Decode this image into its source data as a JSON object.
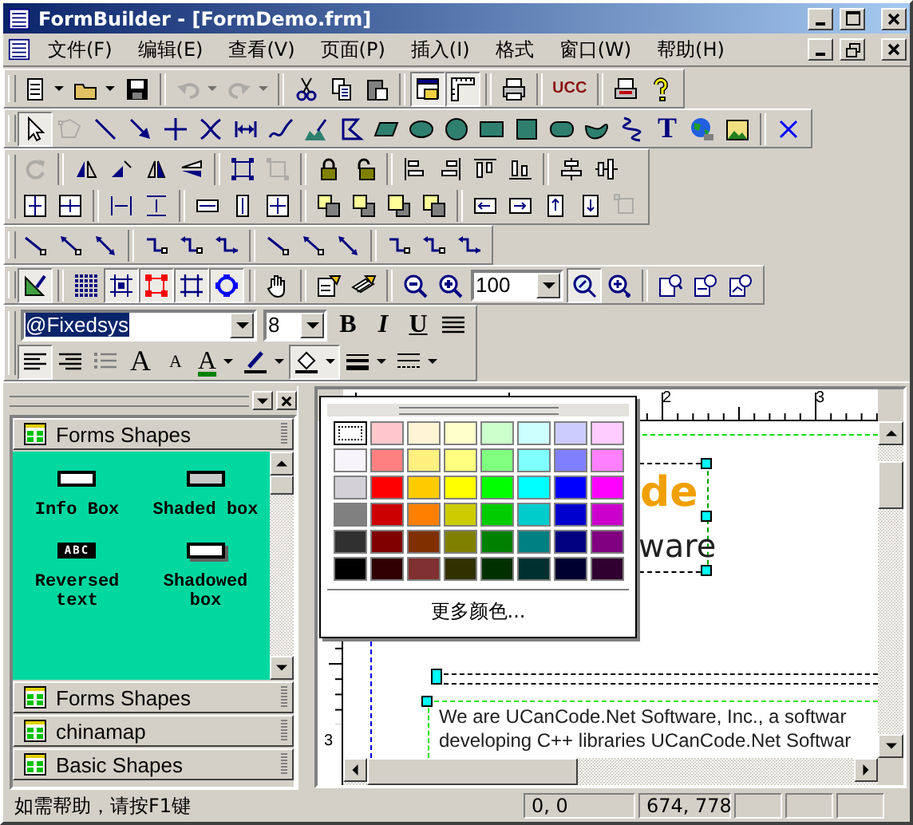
{
  "window": {
    "title": "FormBuilder - [FormDemo.frm]"
  },
  "menu_bar": {
    "items": [
      {
        "label": "文件(F)"
      },
      {
        "label": "编辑(E)"
      },
      {
        "label": "查看(V)"
      },
      {
        "label": "页面(P)"
      },
      {
        "label": "插入(I)"
      },
      {
        "label": "格式"
      },
      {
        "label": "窗口(W)"
      },
      {
        "label": "帮助(H)"
      }
    ]
  },
  "toolbars": [
    {
      "rows": [
        [
          {
            "kind": "split_button",
            "pressed": false,
            "disabled": false
          },
          {
            "kind": "split_button",
            "pressed": false,
            "disabled": false
          },
          {
            "kind": "button",
            "pressed": false,
            "disabled": false
          },
          {
            "kind": "separator"
          },
          {
            "kind": "split_button",
            "pressed": false,
            "disabled": true
          },
          {
            "kind": "split_button",
            "pressed": false,
            "disabled": true
          },
          {
            "kind": "separator"
          },
          {
            "kind": "button",
            "pressed": false,
            "disabled": false
          },
          {
            "kind": "button",
            "pressed": false,
            "disabled": false
          },
          {
            "kind": "button",
            "pressed": false,
            "disabled": false
          },
          {
            "kind": "separator"
          },
          {
            "kind": "button",
            "pressed": true,
            "disabled": false
          },
          {
            "kind": "button",
            "pressed": true,
            "disabled": false
          },
          {
            "kind": "separator"
          },
          {
            "kind": "button",
            "pressed": false,
            "disabled": false
          },
          {
            "kind": "separator"
          },
          {
            "kind": "button",
            "label": "UCC",
            "pressed": false,
            "disabled": false
          },
          {
            "kind": "separator"
          },
          {
            "kind": "button",
            "pressed": false,
            "disabled": false
          },
          {
            "kind": "button",
            "pressed": false,
            "disabled": false
          }
        ]
      ]
    },
    {
      "rows": [
        [
          {
            "kind": "button",
            "pressed": true,
            "disabled": false
          },
          {
            "kind": "button",
            "pressed": false,
            "disabled": true
          },
          {
            "kind": "button",
            "pressed": false,
            "disabled": false
          },
          {
            "kind": "button",
            "pressed": false,
            "disabled": false
          },
          {
            "kind": "button",
            "pressed": false,
            "disabled": false
          },
          {
            "kind": "button",
            "pressed": false,
            "disabled": false
          },
          {
            "kind": "button",
            "pressed": false,
            "disabled": false
          },
          {
            "kind": "button",
            "pressed": false,
            "disabled": false
          },
          {
            "kind": "button",
            "pressed": false,
            "disabled": false
          },
          {
            "kind": "button",
            "pressed": false,
            "disabled": false
          },
          {
            "kind": "button",
            "pressed": false,
            "disabled": false
          },
          {
            "kind": "button",
            "pressed": false,
            "disabled": false
          },
          {
            "kind": "button",
            "pressed": false,
            "disabled": false
          },
          {
            "kind": "button",
            "pressed": false,
            "disabled": false
          },
          {
            "kind": "button",
            "pressed": false,
            "disabled": false
          },
          {
            "kind": "button",
            "pressed": false,
            "disabled": false
          },
          {
            "kind": "button",
            "pressed": false,
            "disabled": false
          },
          {
            "kind": "button",
            "pressed": false,
            "disabled": false
          },
          {
            "kind": "button",
            "label": "T",
            "pressed": false,
            "disabled": false
          },
          {
            "kind": "button",
            "pressed": false,
            "disabled": false
          },
          {
            "kind": "button",
            "pressed": false,
            "disabled": false
          },
          {
            "kind": "separator"
          },
          {
            "kind": "button",
            "pressed": false,
            "disabled": false
          }
        ]
      ]
    },
    {
      "rows": [
        [
          {
            "kind": "button",
            "pressed": false,
            "disabled": true
          },
          {
            "kind": "separator"
          },
          {
            "kind": "button",
            "pressed": false,
            "disabled": false
          },
          {
            "kind": "button",
            "pressed": false,
            "disabled": false
          },
          {
            "kind": "button",
            "pressed": false,
            "disabled": false
          },
          {
            "kind": "button",
            "pressed": false,
            "disabled": false
          },
          {
            "kind": "separator"
          },
          {
            "kind": "button",
            "pressed": false,
            "disabled": false
          },
          {
            "kind": "button",
            "pressed": false,
            "disabled": true
          },
          {
            "kind": "separator"
          },
          {
            "kind": "button",
            "pressed": false,
            "disabled": false
          },
          {
            "kind": "button",
            "pressed": false,
            "disabled": false
          },
          {
            "kind": "separator"
          },
          {
            "kind": "button",
            "pressed": false,
            "disabled": false
          },
          {
            "kind": "button",
            "pressed": false,
            "disabled": false
          },
          {
            "kind": "button",
            "pressed": false,
            "disabled": false
          },
          {
            "kind": "button",
            "pressed": false,
            "disabled": false
          },
          {
            "kind": "separator"
          },
          {
            "kind": "button",
            "pressed": false,
            "disabled": false
          },
          {
            "kind": "button",
            "pressed": false,
            "disabled": false
          }
        ],
        [
          {
            "kind": "button",
            "pressed": false,
            "disabled": false
          },
          {
            "kind": "button",
            "pressed": false,
            "disabled": false
          },
          {
            "kind": "separator"
          },
          {
            "kind": "button",
            "pressed": false,
            "disabled": false
          },
          {
            "kind": "button",
            "pressed": false,
            "disabled": false
          },
          {
            "kind": "separator"
          },
          {
            "kind": "button",
            "pressed": false,
            "disabled": false
          },
          {
            "kind": "button",
            "pressed": false,
            "disabled": false
          },
          {
            "kind": "button",
            "pressed": false,
            "disabled": false
          },
          {
            "kind": "separator"
          },
          {
            "kind": "button",
            "pressed": false,
            "disabled": false
          },
          {
            "kind": "button",
            "pressed": false,
            "disabled": false
          },
          {
            "kind": "button",
            "pressed": false,
            "disabled": false
          },
          {
            "kind": "button",
            "pressed": false,
            "disabled": false
          },
          {
            "kind": "separator"
          },
          {
            "kind": "button",
            "pressed": false,
            "disabled": false
          },
          {
            "kind": "button",
            "pressed": false,
            "disabled": false
          },
          {
            "kind": "button",
            "pressed": false,
            "disabled": false
          },
          {
            "kind": "button",
            "pressed": false,
            "disabled": false
          },
          {
            "kind": "button",
            "pressed": false,
            "disabled": true
          }
        ]
      ]
    },
    {
      "rows": [
        [
          {
            "kind": "button",
            "pressed": false,
            "disabled": false
          },
          {
            "kind": "button",
            "pressed": false,
            "disabled": false
          },
          {
            "kind": "button",
            "pressed": false,
            "disabled": false
          },
          {
            "kind": "separator"
          },
          {
            "kind": "button",
            "pressed": false,
            "disabled": false
          },
          {
            "kind": "button",
            "pressed": false,
            "disabled": false
          },
          {
            "kind": "button",
            "pressed": false,
            "disabled": false
          },
          {
            "kind": "separator"
          },
          {
            "kind": "button",
            "pressed": false,
            "disabled": false
          },
          {
            "kind": "button",
            "pressed": false,
            "disabled": false
          },
          {
            "kind": "button",
            "pressed": false,
            "disabled": false
          },
          {
            "kind": "separator"
          },
          {
            "kind": "button",
            "pressed": false,
            "disabled": false
          },
          {
            "kind": "button",
            "pressed": false,
            "disabled": false
          },
          {
            "kind": "button",
            "pressed": false,
            "disabled": false
          }
        ]
      ]
    },
    {
      "rows": [
        [
          {
            "kind": "button",
            "pressed": true,
            "disabled": false
          },
          {
            "kind": "separator"
          },
          {
            "kind": "button",
            "pressed": false,
            "disabled": false
          },
          {
            "kind": "button",
            "pressed": true,
            "disabled": false
          },
          {
            "kind": "button",
            "pressed": true,
            "disabled": false
          },
          {
            "kind": "button",
            "pressed": true,
            "disabled": false
          },
          {
            "kind": "button",
            "pressed": true,
            "disabled": false
          },
          {
            "kind": "separator"
          },
          {
            "kind": "button",
            "pressed": false,
            "disabled": false
          },
          {
            "kind": "separator"
          },
          {
            "kind": "button",
            "pressed": false,
            "disabled": false
          },
          {
            "kind": "button",
            "pressed": false,
            "disabled": false
          },
          {
            "kind": "separator"
          },
          {
            "kind": "button",
            "pressed": false,
            "disabled": false
          },
          {
            "kind": "button",
            "pressed": false,
            "disabled": false
          },
          {
            "kind": "combo",
            "value": "100",
            "selected": false
          },
          {
            "kind": "button",
            "pressed": true,
            "disabled": false
          },
          {
            "kind": "button",
            "pressed": false,
            "disabled": false
          },
          {
            "kind": "separator"
          },
          {
            "kind": "button",
            "pressed": false,
            "disabled": false
          },
          {
            "kind": "button",
            "pressed": false,
            "disabled": false
          },
          {
            "kind": "button",
            "pressed": false,
            "disabled": false
          }
        ]
      ]
    },
    {
      "rows": [
        [
          {
            "kind": "combo",
            "value": "@Fixedsys",
            "selected": true
          },
          {
            "kind": "combo",
            "value": "8",
            "selected": false
          },
          {
            "kind": "button",
            "label": "B",
            "pressed": false,
            "disabled": false
          },
          {
            "kind": "button",
            "label": "I",
            "pressed": false,
            "disabled": false
          },
          {
            "kind": "button",
            "label": "U",
            "pressed": false,
            "disabled": false
          },
          {
            "kind": "button",
            "pressed": false,
            "disabled": false
          }
        ],
        [
          {
            "kind": "button",
            "pressed": true,
            "disabled": false
          },
          {
            "kind": "button",
            "pressed": false,
            "disabled": false
          },
          {
            "kind": "button",
            "pressed": false,
            "disabled": false
          },
          {
            "kind": "button",
            "label": "A",
            "pressed": false,
            "disabled": false
          },
          {
            "kind": "button",
            "label": "A",
            "pressed": false,
            "disabled": false
          },
          {
            "kind": "split_button",
            "label": "A",
            "pressed": false,
            "disabled": false
          },
          {
            "kind": "split_button",
            "pressed": false,
            "disabled": false
          },
          {
            "kind": "split_button",
            "pressed": true,
            "disabled": false
          },
          {
            "kind": "split_button",
            "pressed": false,
            "disabled": false
          },
          {
            "kind": "split_button",
            "pressed": false,
            "disabled": false
          }
        ]
      ]
    }
  ],
  "shapes_panel": {
    "categories": [
      {
        "label": "Forms Shapes",
        "items": [
          {
            "label": "Info Box"
          },
          {
            "label": "Shaded box"
          },
          {
            "label": "Reversed text",
            "icon_text": "ABC"
          },
          {
            "label": "Shadowed box"
          }
        ]
      },
      {
        "label": "Forms Shapes"
      },
      {
        "label": "chinamap"
      },
      {
        "label": "Basic Shapes"
      }
    ]
  },
  "color_picker": {
    "colors": [
      {
        "color": "#ffffff",
        "selected": true
      },
      {
        "color": "#ffc8cc",
        "selected": false
      },
      {
        "color": "#fff4d4",
        "selected": false
      },
      {
        "color": "#ffffcc",
        "selected": false
      },
      {
        "color": "#ccffcc",
        "selected": false
      },
      {
        "color": "#ccffff",
        "selected": false
      },
      {
        "color": "#ccccff",
        "selected": false
      },
      {
        "color": "#ffccff",
        "selected": false
      },
      {
        "color": "#f8f4fc",
        "selected": false
      },
      {
        "color": "#ff8080",
        "selected": false
      },
      {
        "color": "#fff080",
        "selected": false
      },
      {
        "color": "#ffff80",
        "selected": false
      },
      {
        "color": "#80ff80",
        "selected": false
      },
      {
        "color": "#80ffff",
        "selected": false
      },
      {
        "color": "#8080ff",
        "selected": false
      },
      {
        "color": "#ff80ff",
        "selected": false
      },
      {
        "color": "#d4d0d8",
        "selected": false
      },
      {
        "color": "#ff0000",
        "selected": false
      },
      {
        "color": "#ffcc00",
        "selected": false
      },
      {
        "color": "#ffff00",
        "selected": false
      },
      {
        "color": "#00ff00",
        "selected": false
      },
      {
        "color": "#00ffff",
        "selected": false
      },
      {
        "color": "#0000ff",
        "selected": false
      },
      {
        "color": "#ff00ff",
        "selected": false
      },
      {
        "color": "#808080",
        "selected": false
      },
      {
        "color": "#cc0000",
        "selected": false
      },
      {
        "color": "#ff8000",
        "selected": false
      },
      {
        "color": "#cccc00",
        "selected": false
      },
      {
        "color": "#00cc00",
        "selected": false
      },
      {
        "color": "#00cccc",
        "selected": false
      },
      {
        "color": "#0000cc",
        "selected": false
      },
      {
        "color": "#cc00cc",
        "selected": false
      },
      {
        "color": "#303030",
        "selected": false
      },
      {
        "color": "#800000",
        "selected": false
      },
      {
        "color": "#803000",
        "selected": false
      },
      {
        "color": "#808000",
        "selected": false
      },
      {
        "color": "#008000",
        "selected": false
      },
      {
        "color": "#008080",
        "selected": false
      },
      {
        "color": "#000080",
        "selected": false
      },
      {
        "color": "#800080",
        "selected": false
      },
      {
        "color": "#000000",
        "selected": false
      },
      {
        "color": "#300000",
        "selected": false
      },
      {
        "color": "#803030",
        "selected": false
      },
      {
        "color": "#303000",
        "selected": false
      },
      {
        "color": "#003000",
        "selected": false
      },
      {
        "color": "#003030",
        "selected": false
      },
      {
        "color": "#000030",
        "selected": false
      },
      {
        "color": "#300030",
        "selected": false
      }
    ],
    "more_button": "更多颜色..."
  },
  "canvas": {
    "ruler_labels": [
      "2",
      "3"
    ],
    "vertical_ruler_labels": [
      "3"
    ],
    "logo_parts": [
      "de",
      "ware"
    ],
    "text_lines": [
      "We are UCanCode.Net Software, Inc., a softwar",
      "developing C++ libraries UCanCode.Net Softwar"
    ]
  },
  "status_bar": {
    "help": "如需帮助，请按F1键",
    "panes": [
      "0, 0",
      "674, 778"
    ]
  }
}
